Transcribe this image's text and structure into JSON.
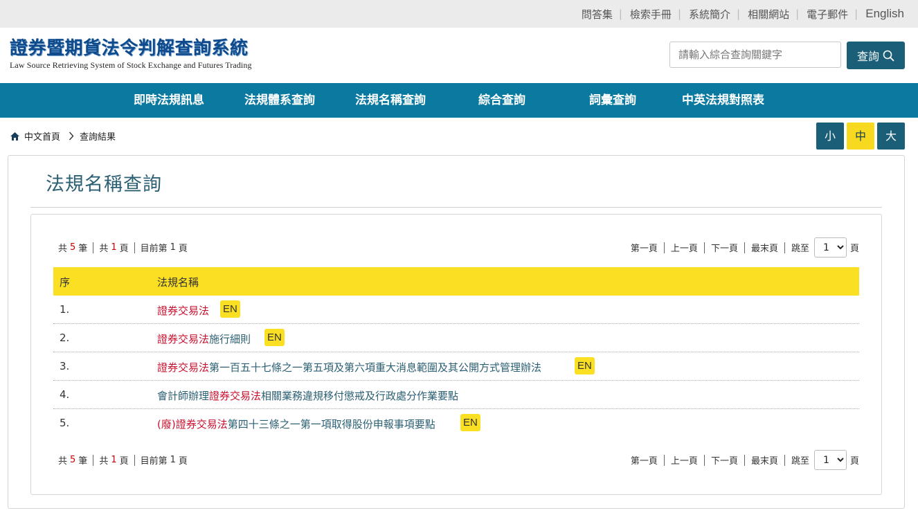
{
  "top_links": [
    "問答集",
    "檢索手冊",
    "系統簡介",
    "相關網站",
    "電子郵件",
    "English"
  ],
  "logo": {
    "title_zh": "證券暨期貨法令判解查詢系統",
    "title_en": "Law Source Retrieving System of Stock Exchange and Futures Trading"
  },
  "search": {
    "placeholder": "請輸入綜合查詢關鍵字",
    "button_label": "查詢"
  },
  "main_nav": [
    "即時法規訊息",
    "法規體系查詢",
    "法規名稱查詢",
    "綜合查詢",
    "詞彙查詢",
    "中英法規對照表"
  ],
  "breadcrumb": {
    "home": "中文首頁",
    "current": "查詢結果"
  },
  "font_size_buttons": [
    "小",
    "中",
    "大"
  ],
  "page_title": "法規名稱查詢",
  "pagination": {
    "total_prefix": "共",
    "total_count": "5",
    "total_unit": "筆",
    "pages_prefix": "共",
    "pages_count": "1",
    "pages_unit": "頁",
    "current_prefix": "目前第",
    "current_page": "1",
    "current_unit": "頁",
    "first": "第一頁",
    "prev": "上一頁",
    "next": "下一頁",
    "last": "最末頁",
    "goto_label": "跳至",
    "goto_value": "1",
    "goto_unit": "頁"
  },
  "table": {
    "headers": [
      "序",
      "法規名稱"
    ],
    "rows": [
      {
        "seq": "1.",
        "pre": "",
        "keyword": "證券交易法",
        "suffix": "",
        "en": "EN"
      },
      {
        "seq": "2.",
        "pre": "",
        "keyword": "證券交易法",
        "suffix": "施行細則",
        "en": "EN"
      },
      {
        "seq": "3.",
        "pre": "",
        "keyword": "證券交易法",
        "suffix": "第一百五十七條之一第五項及第六項重大消息範圍及其公開方式管理辦法",
        "en": "EN"
      },
      {
        "seq": "4.",
        "pre": "會計師辦理",
        "keyword": "證券交易法",
        "suffix": "相關業務違規移付懲戒及行政處分作業要點",
        "en": ""
      },
      {
        "seq": "5.",
        "pre": "(廢)",
        "keyword": "證券交易法",
        "suffix": "第四十三條之一第一項取得股份申報事項要點",
        "en": "EN"
      }
    ]
  },
  "colors": {
    "nav_bg": "#0b7aa0",
    "accent_dark": "#1a5e78",
    "highlight_yellow": "#fadf22",
    "keyword_red": "#c8102e"
  }
}
